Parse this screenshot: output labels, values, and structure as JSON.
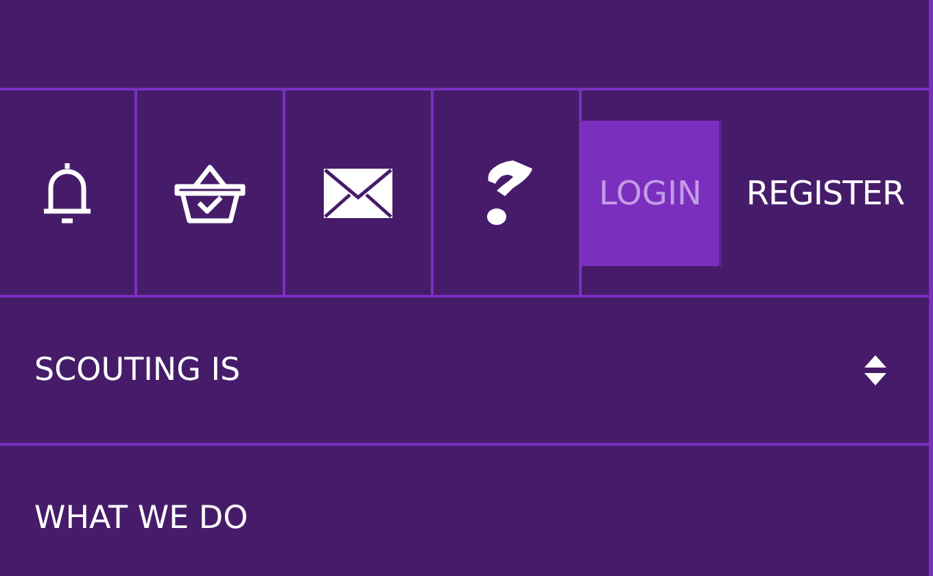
{
  "toolbar": [
    {
      "kind": "bell"
    },
    {
      "kind": "basket"
    },
    {
      "kind": "mail"
    },
    {
      "kind": "help"
    }
  ],
  "auth": [
    {
      "label": "LOGIN",
      "selected": true
    },
    {
      "label": "REGISTER",
      "selected": false
    }
  ],
  "menu": [
    {
      "label": "SCOUTING IS",
      "expandable": true
    },
    {
      "label": "WHAT WE DO",
      "expandable": false
    }
  ]
}
